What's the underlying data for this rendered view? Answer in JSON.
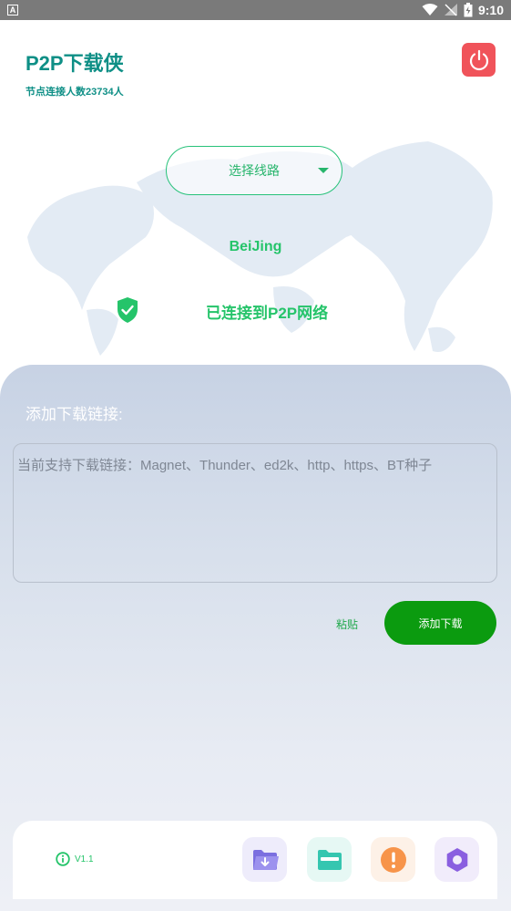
{
  "status_bar": {
    "time": "9:10",
    "left_icon": "A"
  },
  "header": {
    "title": "P2P下载侠",
    "subtitle": "节点连接人数23734人"
  },
  "route": {
    "label": "选择线路"
  },
  "location": {
    "city": "BeiJing",
    "status": "已连接到P2P网络"
  },
  "download": {
    "label": "添加下载链接:",
    "placeholder": "当前支持下载链接：Magnet、Thunder、ed2k、http、https、BT种子",
    "paste_label": "粘贴",
    "add_label": "添加下载"
  },
  "footer": {
    "version": "V1.1",
    "tools": [
      {
        "icon": "folder-download-icon",
        "color": "#7b6fe0",
        "bg": "#eeecfb"
      },
      {
        "icon": "folder-icon",
        "color": "#35c6b0",
        "bg": "#e6f8f4"
      },
      {
        "icon": "alert-icon",
        "color": "#f7944a",
        "bg": "#fdf1e7"
      },
      {
        "icon": "settings-icon",
        "color": "#8a5fe0",
        "bg": "#f1ecfb"
      }
    ]
  },
  "colors": {
    "accent": "#25c46a",
    "brand_teal": "#0e8f86",
    "power": "#f0535a",
    "add_button": "#0b9b0f"
  }
}
